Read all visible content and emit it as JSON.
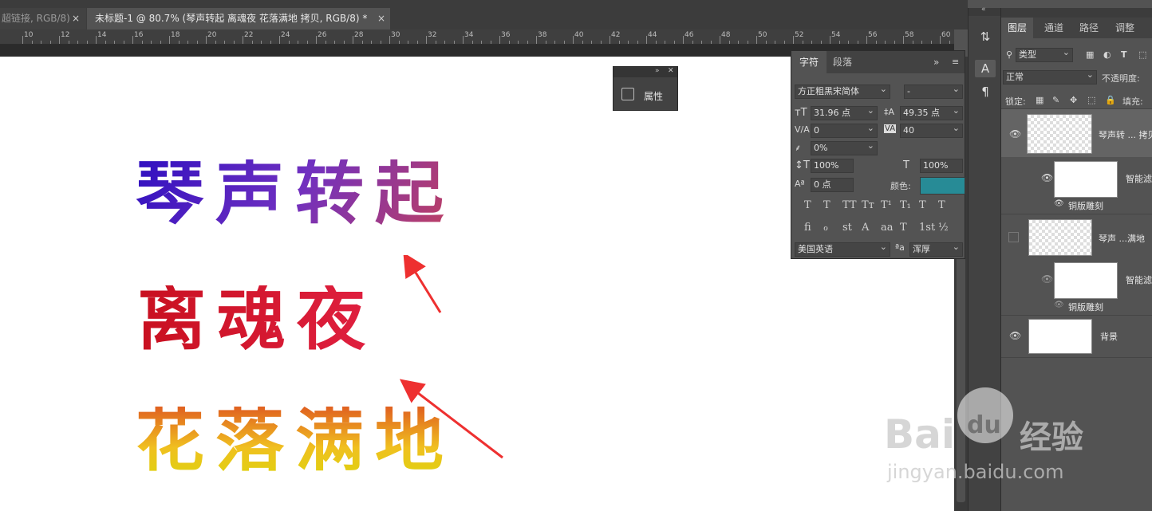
{
  "tabs": [
    {
      "label": "超链接, RGB/8)",
      "close": "×"
    },
    {
      "label": "未标题-1 @ 80.7% (琴声转起 离魂夜 花落满地 拷贝, RGB/8) *",
      "close": "×"
    }
  ],
  "ruler": {
    "labels": [
      "10",
      "12",
      "14",
      "16",
      "18",
      "20",
      "22",
      "24",
      "26",
      "28",
      "30",
      "32",
      "34",
      "36",
      "38",
      "40",
      "42",
      "44",
      "46",
      "48",
      "50",
      "52",
      "54",
      "56",
      "58",
      "60"
    ]
  },
  "canvas_text": {
    "line1": "琴声转起",
    "line2": "离魂夜",
    "line3": "花落满地"
  },
  "props_panel": {
    "label": "属性",
    "arrows": "»",
    "close": "✕"
  },
  "char_panel": {
    "tab_char": "字符",
    "tab_para": "段落",
    "menu": "»",
    "font_family": "方正粗黑宋简体",
    "font_style": "-",
    "font_size": "31.96 点",
    "leading": "49.35 点",
    "kerning": "0",
    "tracking": "40",
    "tsume": "0%",
    "v_scale": "100%",
    "h_scale": "100%",
    "baseline": "0 点",
    "color_label": "颜色:",
    "color": "#278b96",
    "style_glyphs": [
      "T",
      "T",
      "TT",
      "Tт",
      "T¹",
      "T₁",
      "T",
      "T"
    ],
    "ot_glyphs": [
      "fi",
      "ℴ",
      "st",
      "A",
      "aa",
      "T",
      "1st",
      "½"
    ],
    "language": "美国英语",
    "aa_icon": "ªa",
    "antialias": "浑厚"
  },
  "layers_panel": {
    "tabs": [
      "图层",
      "通道",
      "路径",
      "调整"
    ],
    "filter_kind": "类型",
    "blend_mode": "正常",
    "opacity_label": "不透明度:",
    "lock_label": "锁定:",
    "fill_label": "填充:",
    "layers": [
      {
        "name": "琴声转 ... 拷贝",
        "visible": true,
        "thumb": "checker"
      },
      {
        "name": "智能滤",
        "visible": true,
        "thumb": "white"
      },
      {
        "name": "铜版雕刻",
        "visible": true
      },
      {
        "name": "琴声 ...满地",
        "visible": false,
        "thumb": "checker"
      },
      {
        "name": "智能滤",
        "visible": true,
        "thumb": "white"
      },
      {
        "name": "铜版雕刻",
        "visible": true
      },
      {
        "name": "背景",
        "visible": true,
        "thumb": "white"
      }
    ]
  },
  "watermark": {
    "brand": "Bai",
    "du": "du",
    "cn": "经验",
    "url": "jingyan.baidu.com"
  }
}
